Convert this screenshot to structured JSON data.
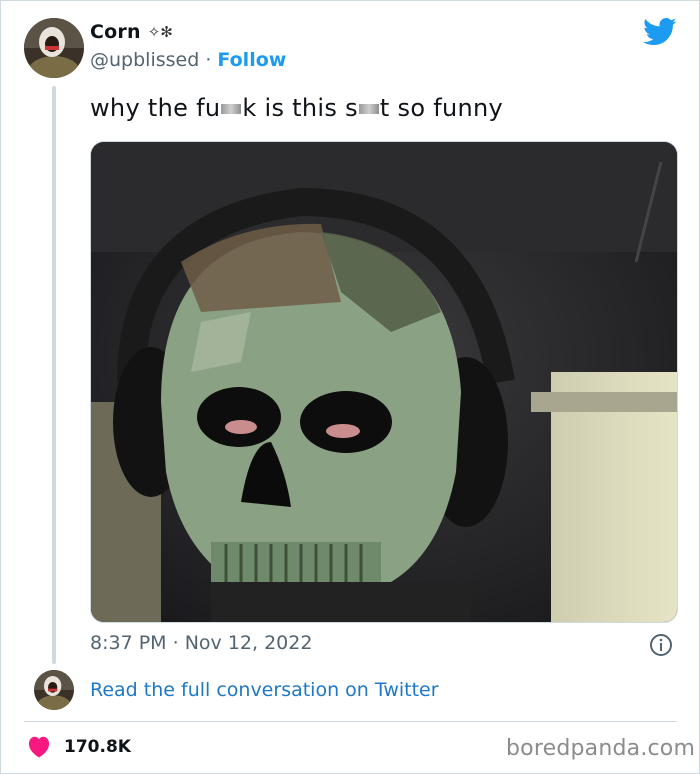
{
  "author": {
    "name": "Corn",
    "name_decoration": "✧✻",
    "handle": "@upblissed",
    "separator": "·",
    "follow_label": "Follow"
  },
  "tweet": {
    "text_parts": [
      "why the fu",
      "k is this s",
      "t so funny"
    ],
    "media_icon": "ghost-skull-mask-photo",
    "time": "8:37 PM",
    "date_separator": "·",
    "date": "Nov 12, 2022"
  },
  "footer": {
    "read_link": "Read the full conversation on Twitter",
    "like_count": "170.8K",
    "watermark": "boredpanda.com"
  },
  "icons": {
    "brand": "twitter-bird-icon",
    "info": "info-icon",
    "like": "heart-icon"
  },
  "colors": {
    "twitter_blue": "#1d9bf0",
    "link_blue": "#1d78c8",
    "heart_pink": "#f91880",
    "muted_text": "#536471",
    "border": "#cfd9de"
  }
}
